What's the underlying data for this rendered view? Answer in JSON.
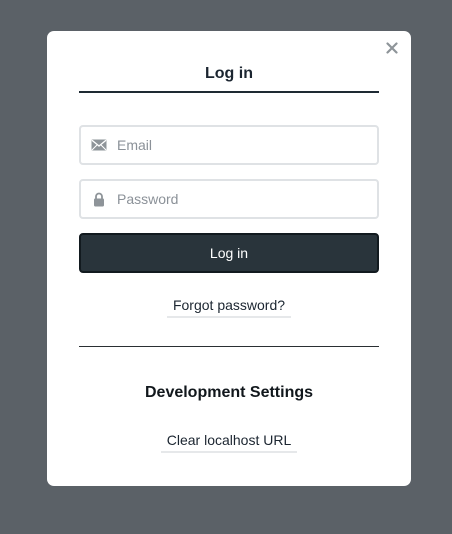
{
  "modal": {
    "close_icon": "close-icon",
    "tab_label": "Log in",
    "email": {
      "placeholder": "Email",
      "value": "",
      "icon": "envelope-icon"
    },
    "password": {
      "placeholder": "Password",
      "value": "",
      "icon": "lock-icon"
    },
    "login_button_label": "Log in",
    "forgot_password_label": "Forgot password?",
    "dev_settings_title": "Development Settings",
    "clear_localhost_label": "Clear localhost URL"
  },
  "colors": {
    "overlay": "#5b6167",
    "primary_button": "#29343b",
    "text": "#1b2530",
    "input_border": "#dfe2e5"
  }
}
